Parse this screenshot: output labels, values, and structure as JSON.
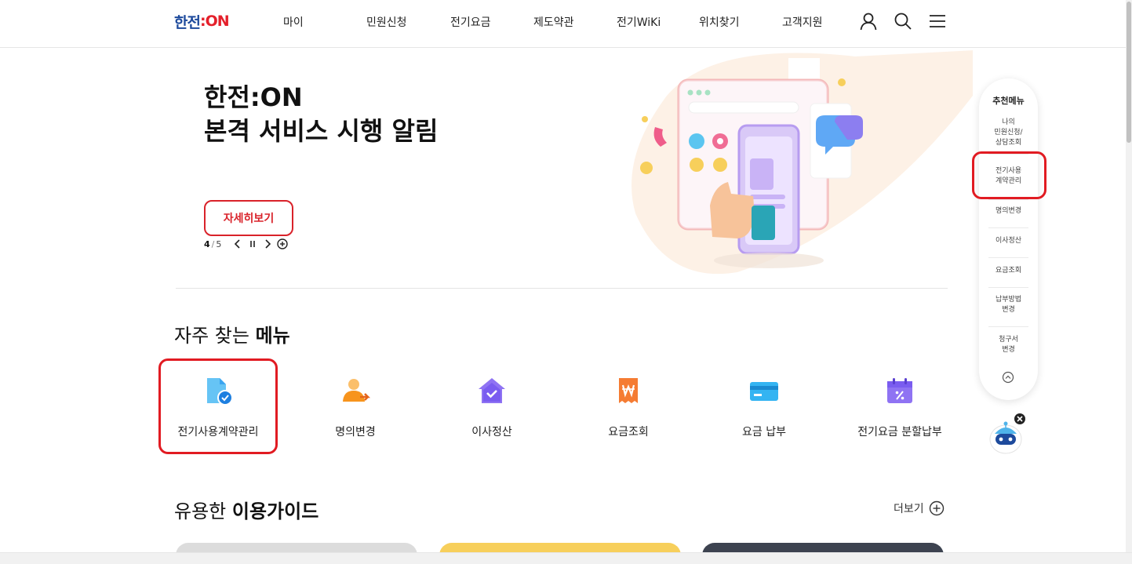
{
  "header": {
    "logo_part1": "한전",
    "logo_part2": ":ON",
    "nav": [
      "마이",
      "민원신청",
      "전기요금",
      "제도약관",
      "전기WiKi",
      "위치찾기",
      "고객지원"
    ],
    "icons": [
      "user-icon",
      "search-icon",
      "menu-icon"
    ]
  },
  "hero": {
    "title_line1": "한전:ON",
    "title_line2": "본격 서비스 시행 알림",
    "button": "자세히보기",
    "pager_current": "4",
    "pager_sep": "/",
    "pager_total": "5",
    "controls": [
      "chevron-left-icon",
      "pause-icon",
      "chevron-right-icon",
      "plus-circle-icon"
    ]
  },
  "frequent": {
    "title_normal": "자주 찾는 ",
    "title_bold": "메뉴",
    "items": [
      {
        "label": "전기사용계약관리",
        "icon": "document-check-icon",
        "color": "#3aa5f0"
      },
      {
        "label": "명의변경",
        "icon": "person-transfer-icon",
        "color": "#f7941d"
      },
      {
        "label": "이사정산",
        "icon": "house-check-icon",
        "color": "#7a5cf0"
      },
      {
        "label": "요금조회",
        "icon": "receipt-won-icon",
        "color": "#f57c33"
      },
      {
        "label": "요금 납부",
        "icon": "card-icon",
        "color": "#34b4f2"
      },
      {
        "label": "전기요금 분할납부",
        "icon": "calendar-percent-icon",
        "color": "#7a5cf0"
      }
    ]
  },
  "guide": {
    "title_normal": "유용한 ",
    "title_bold": "이용가이드",
    "more": "더보기"
  },
  "side_menu": {
    "title": "추천메뉴",
    "items": [
      "나의\n민원신청/\n상담조회",
      "전기사용\n계약관리",
      "명의변경",
      "이사정산",
      "요금조회",
      "납부방법\n변경",
      "청구서\n변경"
    ]
  },
  "colors": {
    "accent_red": "#e11b22",
    "brand_blue": "#1d4a9c"
  }
}
